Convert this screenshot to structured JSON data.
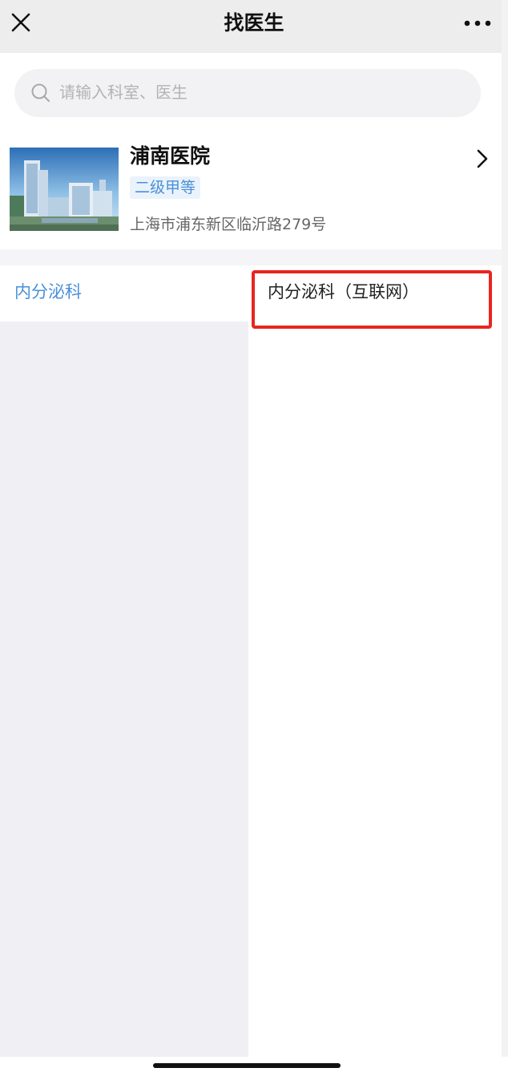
{
  "navbar": {
    "title": "找医生",
    "close_icon": "close-icon",
    "more_icon": "more-icon"
  },
  "search": {
    "placeholder": "请输入科室、医生",
    "icon": "search-icon"
  },
  "hospital": {
    "name": "浦南医院",
    "grade": "二级甲等",
    "address": "上海市浦东新区临沂路279号",
    "image_icon": "hospital-building-image",
    "chevron_icon": "chevron-right-icon"
  },
  "departments": {
    "left": [
      {
        "label": "内分泌科",
        "selected": true
      }
    ],
    "right": [
      {
        "label": "内分泌科（互联网）"
      }
    ]
  },
  "colors": {
    "accent": "#4a90d9",
    "highlight": "#e8251f",
    "navbar_bg": "#ededed",
    "left_panel_bg": "#efeff4"
  }
}
